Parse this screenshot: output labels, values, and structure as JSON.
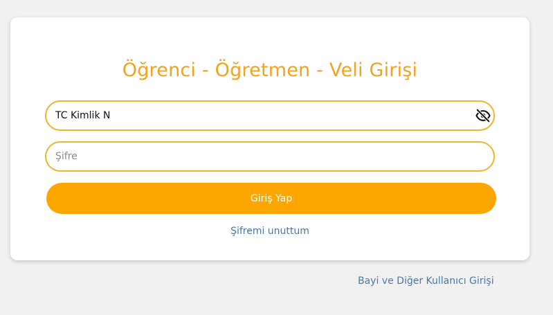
{
  "login": {
    "title": "Öğrenci - Öğretmen - Veli Girişi",
    "tc_field": {
      "value": "TC Kimlik N",
      "placeholder": "TC Kimlik N"
    },
    "password_field": {
      "value": "",
      "placeholder": "Şifre"
    },
    "toggle_icon": "eye-slash-icon",
    "submit_label": "Giriş Yap",
    "forgot_label": "Şifremi unuttum"
  },
  "footer": {
    "dealer_link": "Bayi ve Diğer Kullanıcı Girişi"
  },
  "colors": {
    "accent": "#fea600",
    "title": "#f3a21d",
    "border": "#f0b32e",
    "link": "#4a77a8",
    "background": "#f1f1f1"
  }
}
